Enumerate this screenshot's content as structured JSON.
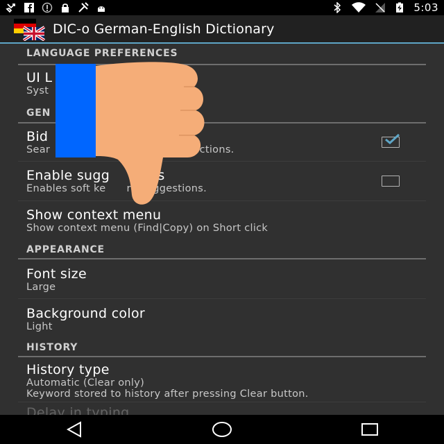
{
  "status_bar": {
    "time": "5:03",
    "left_icons": [
      "missed-call-icon",
      "facebook-icon",
      "cast-icon",
      "lock-icon",
      "tools-icon",
      "android-icon"
    ],
    "right_icons": [
      "bluetooth-icon",
      "wifi-icon",
      "no-signal-icon",
      "battery-charging-icon"
    ]
  },
  "app": {
    "title": "DIC-o German-English Dictionary"
  },
  "categories": {
    "language": "LANGUAGE PREFERENCES",
    "general": "GEN",
    "appearance": "APPEARANCE",
    "history": "HISTORY"
  },
  "prefs": {
    "ui_language": {
      "title": "UI L",
      "summary": "Syst"
    },
    "bidirectional": {
      "title": "Bid",
      "summary": "Sear",
      "summary_tail": "n directions.",
      "checked": true
    },
    "suggestions": {
      "title": "Enable sugg",
      "title_tail": "ons",
      "summary": "Enables soft ke",
      "summary_tail": "rd suggestions.",
      "checked": false
    },
    "context_menu": {
      "title": "Show context menu",
      "summary": "Show context menu (Find|Copy) on Short click"
    },
    "font_size": {
      "title": "Font size",
      "summary": "Large"
    },
    "background": {
      "title": "Background color",
      "summary": "Light"
    },
    "history_type": {
      "title": "History type",
      "summary": "Automatic (Clear only)",
      "summary2": "Keyword stored to history after pressing Clear button."
    },
    "delay": {
      "title": "Delay in typing"
    }
  },
  "navigation": {
    "back": "back-icon",
    "home": "home-icon",
    "recents": "recents-icon"
  },
  "colors": {
    "accent": "#5ea6c7",
    "checkbox_check": "#5ea6c7",
    "overlay_blue": "#0066ff",
    "thumb_skin": "#f5ad78"
  }
}
